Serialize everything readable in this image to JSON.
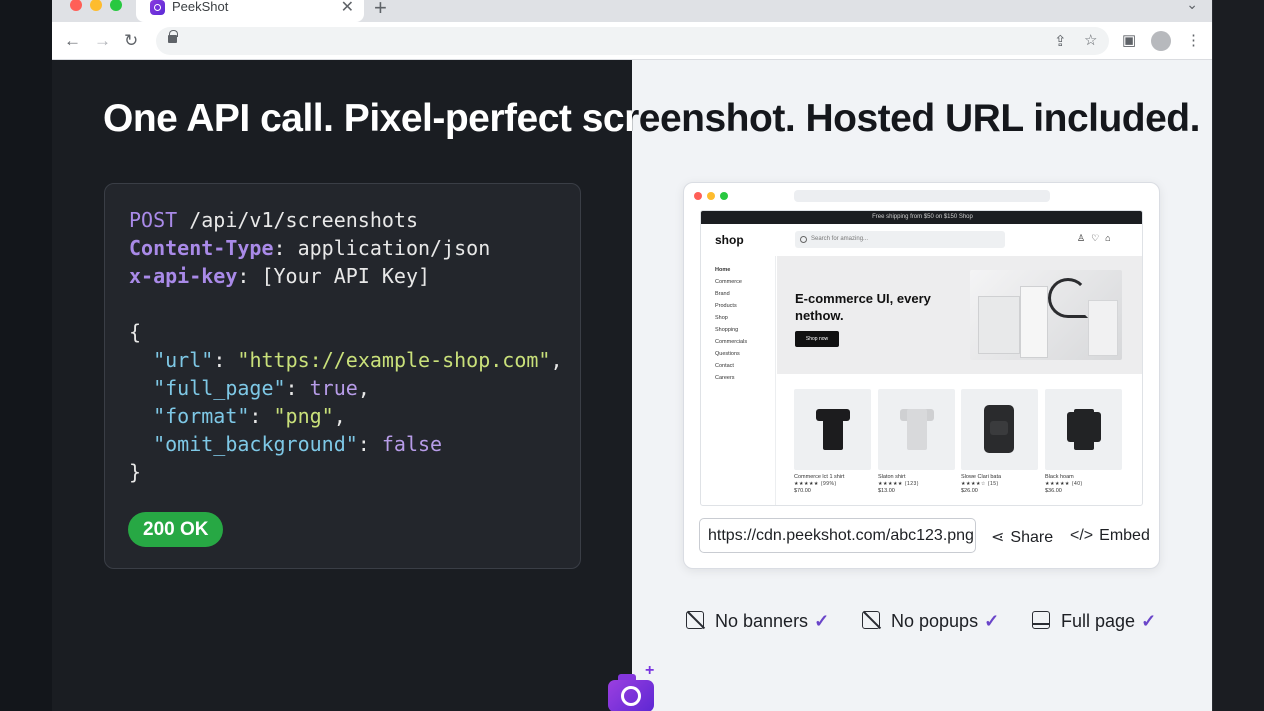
{
  "browser": {
    "tab_title": "PeekShot",
    "tab_close": "✕",
    "new_tab": "+",
    "tab_menu": "⌄",
    "nav_back": "←",
    "nav_forward": "→",
    "nav_reload": "↻",
    "address": "",
    "share_glyph": "⇪",
    "star_glyph": "☆",
    "sidepanel_glyph": "▣",
    "menu_glyph": "⋮"
  },
  "hero": {
    "headline": "One API call. Pixel-perfect screenshot. Hosted URL included."
  },
  "code": {
    "method": "POST",
    "path": " /api/v1/screenshots",
    "header1_key": "Content-Type",
    "header1_val": ": application/json",
    "header2_key": "x-api-key",
    "header2_val": ": [Your API Key]",
    "open_brace": "{",
    "close_brace": "}",
    "url_key": "\"url\"",
    "url_val": "\"https://example-shop.com\"",
    "full_page_key": "\"full_page\"",
    "full_page_val": "true",
    "format_key": "\"format\"",
    "format_val": "\"png\"",
    "omit_key": "\"omit_background\"",
    "omit_val": "false",
    "status": "200 OK"
  },
  "preview": {
    "shop": {
      "banner": "Free shipping from $50 on $150 Shop",
      "logo": "shop",
      "search_placeholder": "Search for amazing...",
      "icons": "♙♡⌂",
      "side_items": [
        "Home",
        "Commerce",
        "Brand",
        "Products",
        "Shop",
        "Shopping",
        "Commercials",
        "Questions",
        "Contact",
        "Careers"
      ],
      "hero_title": "E-commerce UI, every nethow.",
      "hero_button": "Shop now",
      "products": [
        {
          "name": "Commerce lct 1 shirt",
          "stars": "★★★★★ (99%)",
          "price": "$70.00"
        },
        {
          "name": "Slaton shirt",
          "stars": "★★★★★ (123)",
          "price": "$13.00"
        },
        {
          "name": "Slowe Clari bata",
          "stars": "★★★★☆ (15)",
          "price": "$26.00"
        },
        {
          "name": "Black hoam",
          "stars": "★★★★★ (40)",
          "price": "$36.00"
        }
      ]
    },
    "hosted_url": "https://cdn.peekshot.com/abc123.png",
    "share_label": "Share",
    "share_glyph": "⋖",
    "embed_label": "Embed",
    "embed_glyph": "</>"
  },
  "features": [
    {
      "label": "No banners",
      "check": "✓"
    },
    {
      "label": "No popups",
      "check": "✓"
    },
    {
      "label": "Full page",
      "check": "✓"
    }
  ],
  "colors": {
    "accent_purple": "#6a45c9",
    "status_green": "#27a844",
    "dark_panel": "#1a1d22",
    "light_panel": "#f1f3f6"
  }
}
